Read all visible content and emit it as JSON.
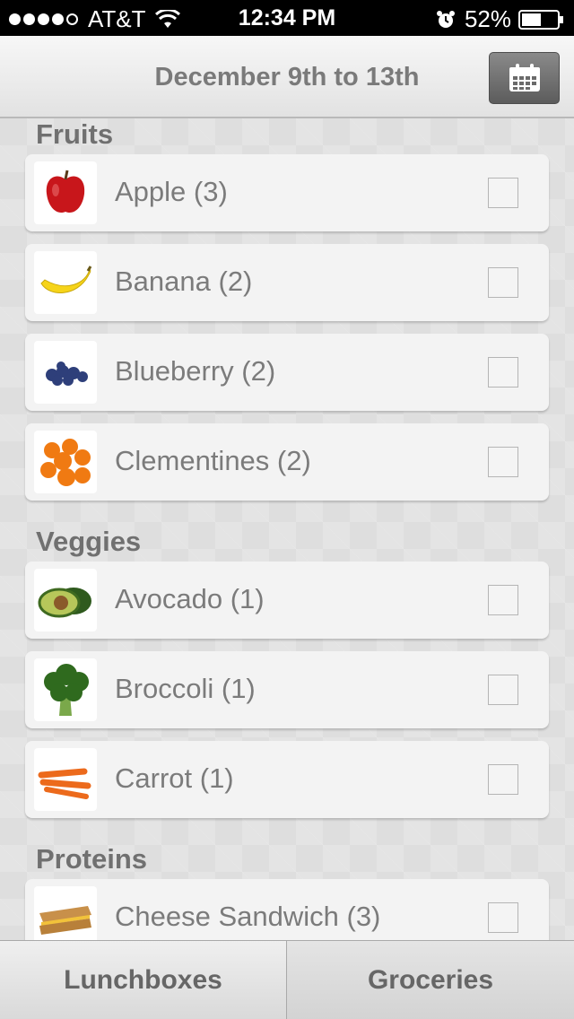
{
  "status_bar": {
    "carrier": "AT&T",
    "time": "12:34 PM",
    "battery": "52%",
    "signal_icon": "signal-dots-icon",
    "wifi_icon": "wifi-icon",
    "alarm_icon": "alarm-icon",
    "battery_icon": "battery-icon"
  },
  "nav": {
    "title": "December 9th to 13th",
    "calendar_icon": "calendar-icon"
  },
  "sections": [
    {
      "title": "Fruits",
      "items": [
        {
          "label": "Apple (3)",
          "icon": "apple-icon",
          "checked": false
        },
        {
          "label": "Banana (2)",
          "icon": "banana-icon",
          "checked": false
        },
        {
          "label": "Blueberry (2)",
          "icon": "blueberry-icon",
          "checked": false
        },
        {
          "label": "Clementines (2)",
          "icon": "clementines-icon",
          "checked": false
        }
      ]
    },
    {
      "title": "Veggies",
      "items": [
        {
          "label": "Avocado (1)",
          "icon": "avocado-icon",
          "checked": false
        },
        {
          "label": "Broccoli (1)",
          "icon": "broccoli-icon",
          "checked": false
        },
        {
          "label": "Carrot (1)",
          "icon": "carrot-icon",
          "checked": false
        }
      ]
    },
    {
      "title": "Proteins",
      "items": [
        {
          "label": "Cheese Sandwich (3)",
          "icon": "cheese-sandwich-icon",
          "checked": false
        }
      ]
    }
  ],
  "tabs": [
    {
      "label": "Lunchboxes",
      "selected": false
    },
    {
      "label": "Groceries",
      "selected": true
    }
  ],
  "colors": {
    "section_text": "#707070",
    "item_text": "#7b7b7b",
    "calendar_button": "#6e6e6e"
  }
}
